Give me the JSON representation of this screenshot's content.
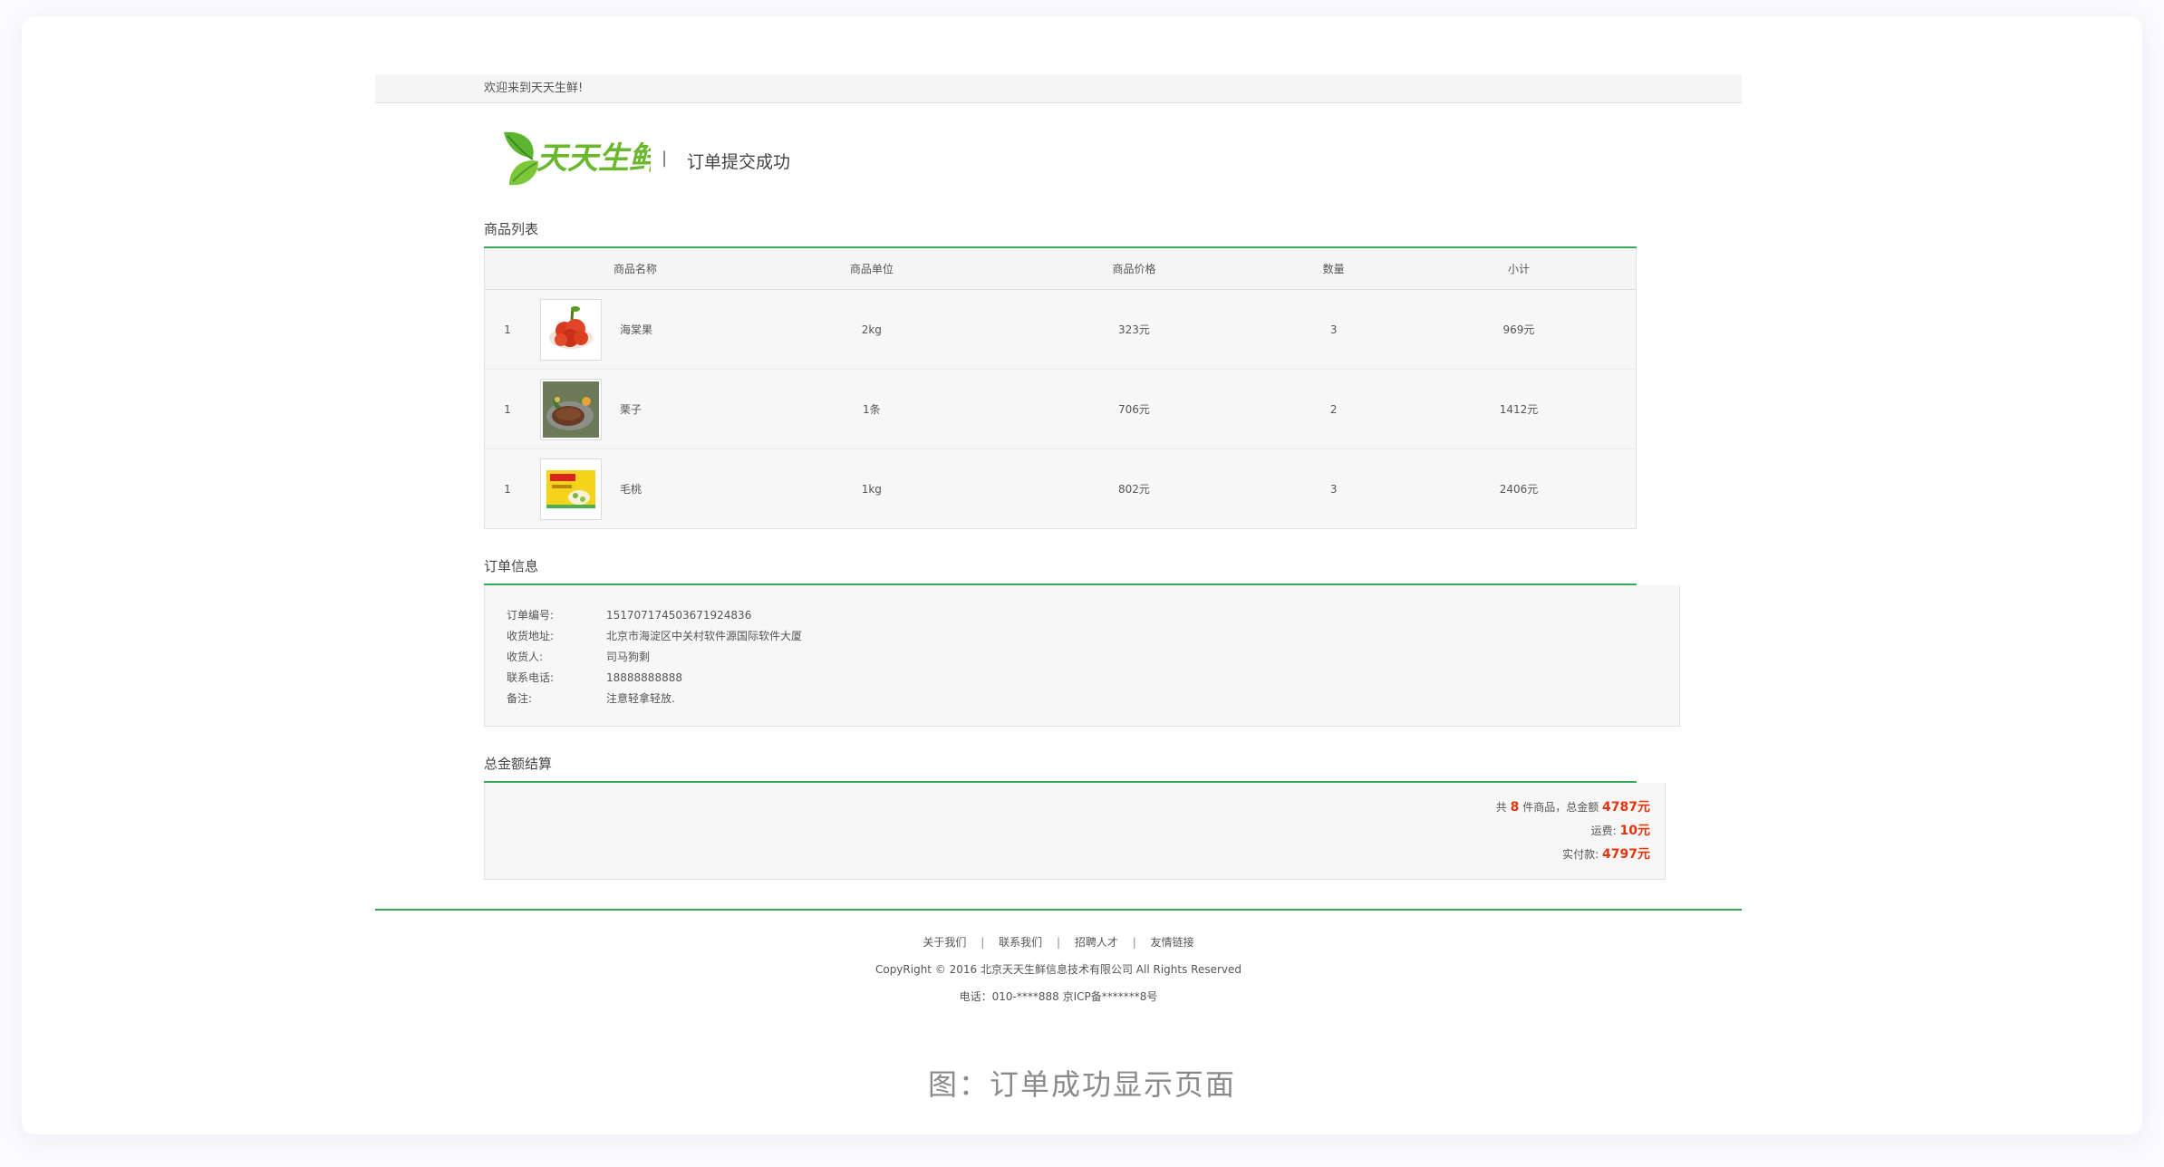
{
  "topbar": {
    "welcome": "欢迎来到天天生鲜!"
  },
  "header": {
    "logo_text": "天天生鲜",
    "separator": "|",
    "subtitle": "订单提交成功"
  },
  "goods_section": {
    "title": "商品列表",
    "columns": [
      "商品名称",
      "商品单位",
      "商品价格",
      "数量",
      "小计"
    ],
    "rows": [
      {
        "index": "1",
        "image": "apple-fruit-image",
        "name": "海棠果",
        "unit": "2kg",
        "price": "323元",
        "qty": "3",
        "subtotal": "969元"
      },
      {
        "index": "1",
        "image": "steak-dish-image",
        "name": "栗子",
        "unit": "1条",
        "price": "706元",
        "qty": "2",
        "subtotal": "1412元"
      },
      {
        "index": "1",
        "image": "snack-package-image",
        "name": "毛桃",
        "unit": "1kg",
        "price": "802元",
        "qty": "3",
        "subtotal": "2406元"
      }
    ]
  },
  "order_section": {
    "title": "订单信息",
    "fields": [
      {
        "label": "订单编号:",
        "value": "151707174503671924836"
      },
      {
        "label": "收货地址:",
        "value": "北京市海淀区中关村软件源国际软件大厦"
      },
      {
        "label": "收货人:",
        "value": "司马狗剩"
      },
      {
        "label": "联系电话:",
        "value": "18888888888"
      },
      {
        "label": "备注:",
        "value": "注意轻拿轻放."
      }
    ]
  },
  "total_section": {
    "title": "总金额结算",
    "count_prefix": "共",
    "count": "8",
    "count_suffix": "件商品，总金额",
    "total_amount": "4787元",
    "freight_label": "运费:",
    "freight": "10元",
    "paid_label": "实付款:",
    "paid": "4797元"
  },
  "footer": {
    "links": [
      "关于我们",
      "联系我们",
      "招聘人才",
      "友情链接"
    ],
    "separator": "|",
    "copyright": "CopyRight © 2016 北京天天生鲜信息技术有限公司 All Rights Reserved",
    "contact": "电话：010-****888 京ICP备*******8号"
  },
  "caption": "图：订单成功显示页面",
  "colors": {
    "accent_green": "#37ab5c",
    "price_red": "#e3350d",
    "panel_bg": "#f7f7f7"
  }
}
